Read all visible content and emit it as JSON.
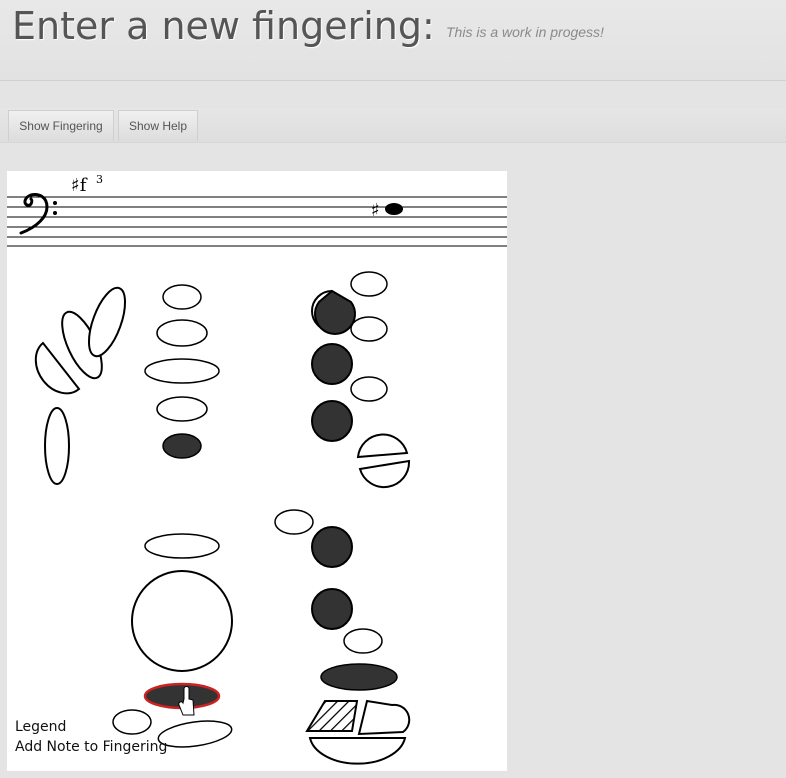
{
  "header": {
    "title": "Enter a new fingering:",
    "subtitle": "This is a work in progess!"
  },
  "toolbar": {
    "show_fingering_label": "Show Fingering",
    "show_help_label": "Show Help"
  },
  "staff": {
    "clef": "bass-clef",
    "note_name": "♯f",
    "octave": "3",
    "accidental": "♯"
  },
  "legend": {
    "title": "Legend",
    "item": "Add Note to Fingering"
  },
  "colors": {
    "filled_key": "#333333",
    "highlight_outline": "#cc2222",
    "background": "#e4e4e4"
  }
}
